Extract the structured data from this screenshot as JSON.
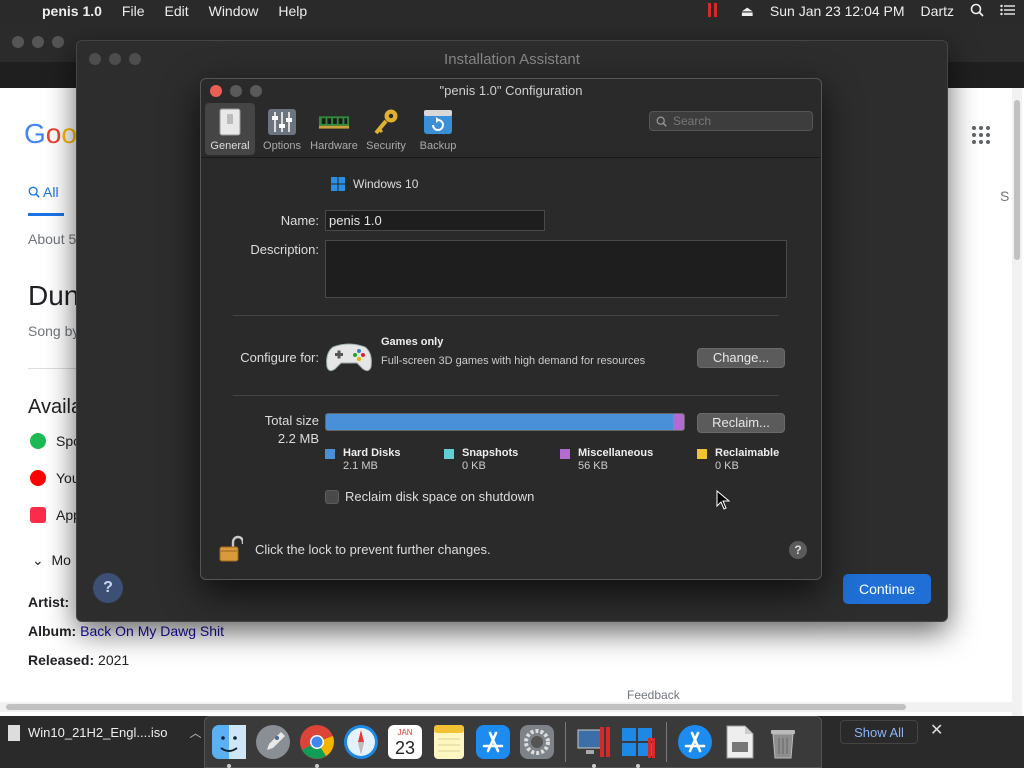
{
  "menubar": {
    "app_name": "penis 1.0",
    "items": [
      "File",
      "Edit",
      "Window",
      "Help"
    ],
    "datetime": "Sun Jan 23  12:04 PM",
    "user": "Dartz"
  },
  "google_page": {
    "logo_letters": [
      "G",
      "o",
      "o"
    ],
    "tab_all": "All",
    "about": "About 5",
    "title": "Dun",
    "song_by": "Song by",
    "available": "Availa",
    "services": [
      "Spo",
      "You",
      "App"
    ],
    "more": "Mo",
    "facts": {
      "artist_label": "Artist:",
      "album_label": "Album:",
      "album_value": "Back On My Dawg Shit",
      "released_label": "Released:",
      "released_value": "2021"
    },
    "side_s": "S",
    "feedback": "Feedback"
  },
  "assistant": {
    "title": "Installation Assistant",
    "help": "?",
    "continue_label": "Continue"
  },
  "config": {
    "title": "\"penis 1.0\" Configuration",
    "toolbar": [
      {
        "label": "General",
        "icon": "general-switch-icon",
        "selected": true
      },
      {
        "label": "Options",
        "icon": "options-sliders-icon",
        "selected": false
      },
      {
        "label": "Hardware",
        "icon": "hardware-ram-icon",
        "selected": false
      },
      {
        "label": "Security",
        "icon": "security-key-icon",
        "selected": false
      },
      {
        "label": "Backup",
        "icon": "backup-icon",
        "selected": false
      }
    ],
    "search_placeholder": "Search",
    "os_name": "Windows 10",
    "name_label": "Name:",
    "name_value": "penis 1.0",
    "description_label": "Description:",
    "configure_for_label": "Configure for:",
    "profile_title": "Games only",
    "profile_desc": "Full-screen 3D games with high demand for resources",
    "change_button": "Change...",
    "total_size_label": "Total size",
    "total_size_value": "2.2 MB",
    "reclaim_button": "Reclaim...",
    "size_breakdown": [
      {
        "name": "Hard Disks",
        "value": "2.1 MB",
        "color": "#4a90d9",
        "fraction": 0.97
      },
      {
        "name": "Snapshots",
        "value": "0 KB",
        "color": "#5fd0d6",
        "fraction": 0.0
      },
      {
        "name": "Miscellaneous",
        "value": "56 KB",
        "color": "#b36bd1",
        "fraction": 0.03
      },
      {
        "name": "Reclaimable",
        "value": "0 KB",
        "color": "#f2c232",
        "fraction": 0.0
      }
    ],
    "reclaim_checkbox_label": "Reclaim disk space on shutdown",
    "reclaim_checkbox_checked": false,
    "lock_text": "Click the lock to prevent further changes.",
    "help": "?"
  },
  "downloads": {
    "file_name": "Win10_21H2_Engl....iso",
    "show_all": "Show All",
    "close": "✕"
  },
  "dock_apps": [
    "Finder",
    "Launchpad",
    "Chrome",
    "Safari",
    "Calendar",
    "Notes",
    "App Store",
    "System Preferences",
    "Parallels",
    "Windows 10",
    "App Store Downloads",
    "Preview",
    "Trash"
  ],
  "calendar_tile": {
    "month": "JAN",
    "day": "23"
  }
}
